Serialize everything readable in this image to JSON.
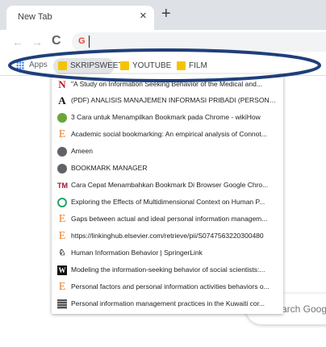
{
  "tab": {
    "title": "New Tab",
    "close": "×",
    "new_tab": "+"
  },
  "toolbar": {
    "back": "←",
    "forward": "→",
    "reload": "C",
    "omni_icon": "G"
  },
  "bookmarks_bar": {
    "apps_label": "Apps",
    "items": [
      {
        "label": "SKRIPSWEET",
        "active": true
      },
      {
        "label": "YOUTUBE"
      },
      {
        "label": "FILM"
      }
    ]
  },
  "dropdown": {
    "items": [
      {
        "icon": "nejm-icon",
        "glyph": "N",
        "label": "\"A Study on Information Seeking Behavior of the Medical and..."
      },
      {
        "icon": "academia-icon",
        "glyph": "A",
        "label": "(PDF) ANALISIS MANAJEMEN INFORMASI PRIBADI (PERSONAL..."
      },
      {
        "icon": "wikihow-icon",
        "glyph": "",
        "label": "3 Cara untuk Menampilkan Bookmark pada Chrome - wikiHow"
      },
      {
        "icon": "elsevier-icon",
        "glyph": "E",
        "label": "Academic social bookmarking: An empirical analysis of Connot..."
      },
      {
        "icon": "globe-icon",
        "glyph": "",
        "label": "Ameen"
      },
      {
        "icon": "globe-icon",
        "glyph": "",
        "label": "BOOKMARK MANAGER"
      },
      {
        "icon": "tm-icon",
        "glyph": "TM",
        "label": "Cara Cepat Menambahkan Bookmark Di Browser Google Chro..."
      },
      {
        "icon": "ring-icon",
        "glyph": "",
        "label": "Exploring the Effects of Multidimensional Context on Human P..."
      },
      {
        "icon": "elsevier-icon",
        "glyph": "E",
        "label": "Gaps between actual and ideal personal information managem..."
      },
      {
        "icon": "elsevier-icon",
        "glyph": "E",
        "label": "https://linkinghub.elsevier.com/retrieve/pii/S0747563220300480"
      },
      {
        "icon": "springer-icon",
        "glyph": "♘",
        "label": "Human Information Behavior | SpringerLink"
      },
      {
        "icon": "wiley-icon",
        "glyph": "W",
        "label": "Modeling the information-seeking behavior of social scientists:..."
      },
      {
        "icon": "elsevier-icon",
        "glyph": "E",
        "label": "Personal factors and personal information activities behaviors o..."
      },
      {
        "icon": "document-icon",
        "glyph": "",
        "label": "Personal information management practices in the Kuwaiti cor..."
      }
    ]
  },
  "search": {
    "placeholder": "arch Goog"
  },
  "colors": {
    "tabstrip": "#dee1e6",
    "folder": "#f5c400",
    "ellipse": "#1f3f7a",
    "elsevier": "#f07e26"
  }
}
